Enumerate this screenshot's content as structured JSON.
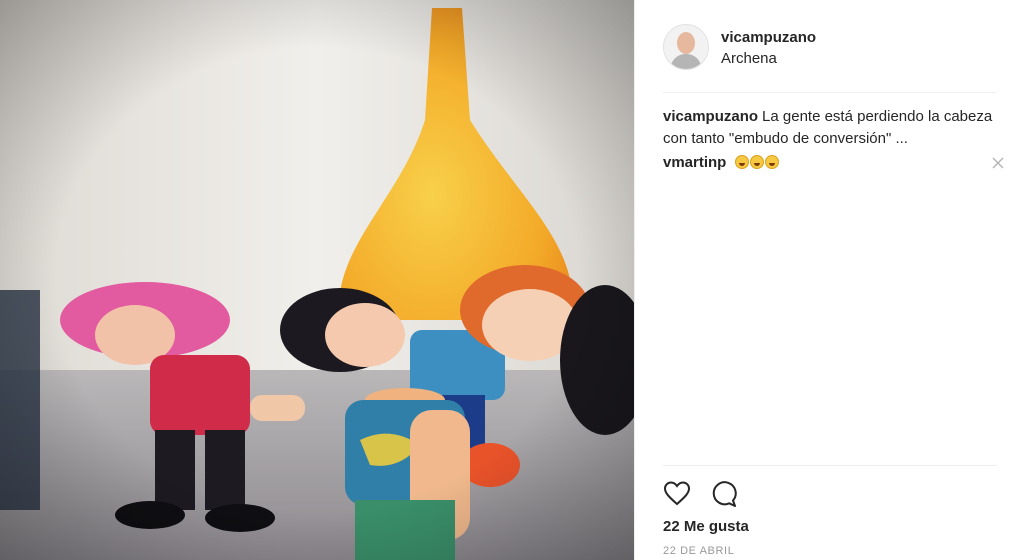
{
  "post": {
    "username": "vicampuzano",
    "location": "Archena",
    "image_alt": "Muñecos sin cabeza frente a un embudo amarillo"
  },
  "comments": [
    {
      "user": "vicampuzano",
      "text": "La gente está perdiendo la cabeza con tanto \"embudo de conversión\" ..."
    },
    {
      "user": "vmartinp",
      "text": "",
      "emoji": [
        "laughing-tears",
        "laughing-tears",
        "laughing-tears"
      ]
    }
  ],
  "actions": {
    "like_icon": "heart-icon",
    "comment_icon": "comment-bubble-icon"
  },
  "likes_text": "22 Me gusta",
  "date_text": "22 DE ABRIL",
  "colors": {
    "text": "#262626",
    "muted": "#999999",
    "divider": "#efefef",
    "funnel": "#f5b21e"
  }
}
